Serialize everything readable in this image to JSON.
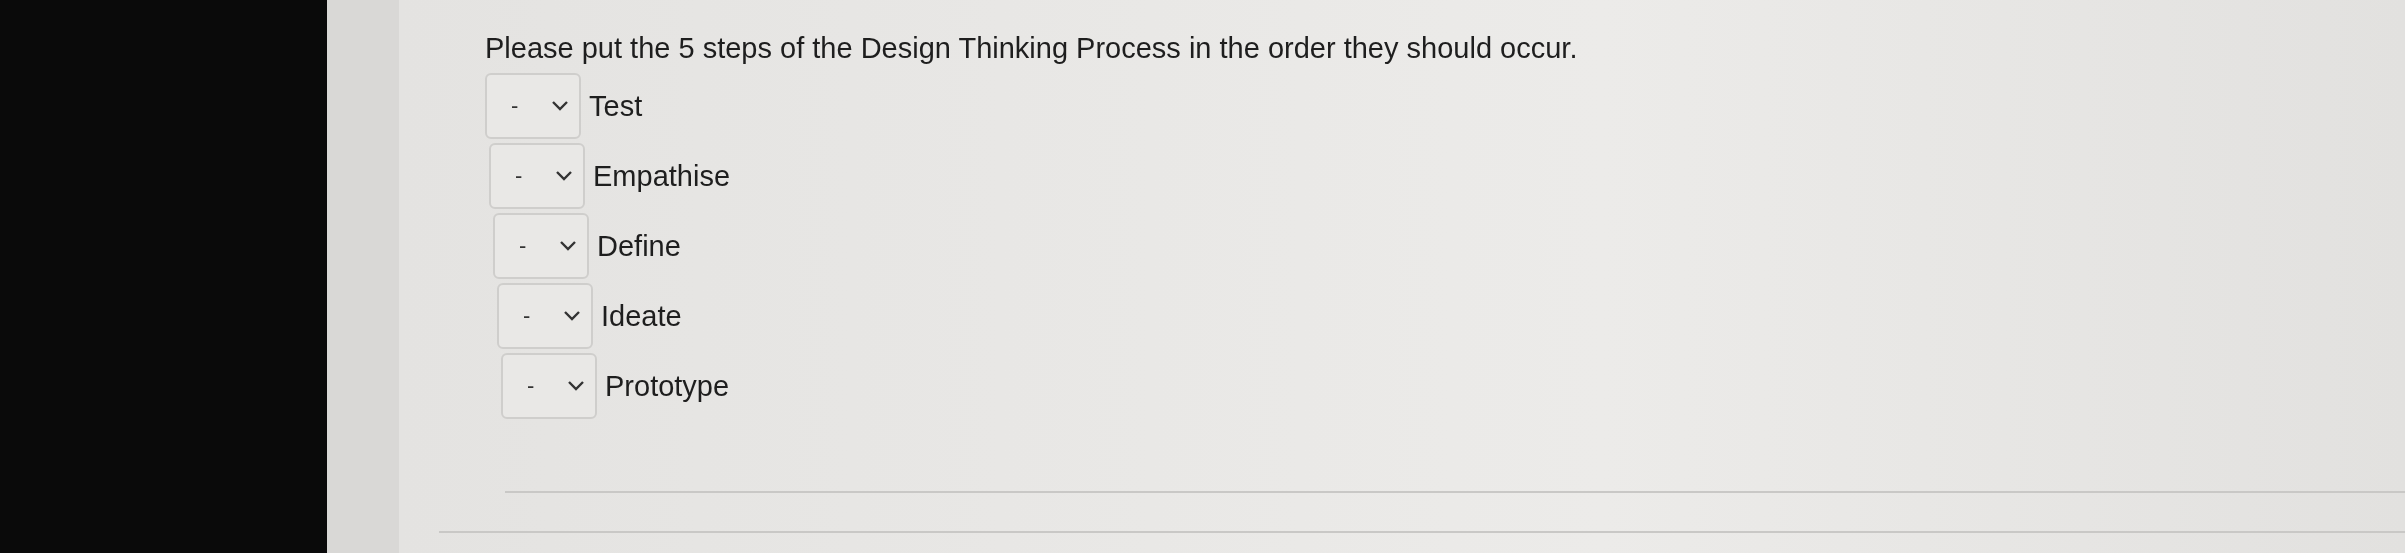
{
  "question": "Please put the 5 steps of the Design Thinking Process in the order they should occur.",
  "items": [
    {
      "value": "-",
      "label": "Test"
    },
    {
      "value": "-",
      "label": "Empathise"
    },
    {
      "value": "-",
      "label": "Define"
    },
    {
      "value": "-",
      "label": "Ideate"
    },
    {
      "value": "-",
      "label": "Prototype"
    }
  ]
}
